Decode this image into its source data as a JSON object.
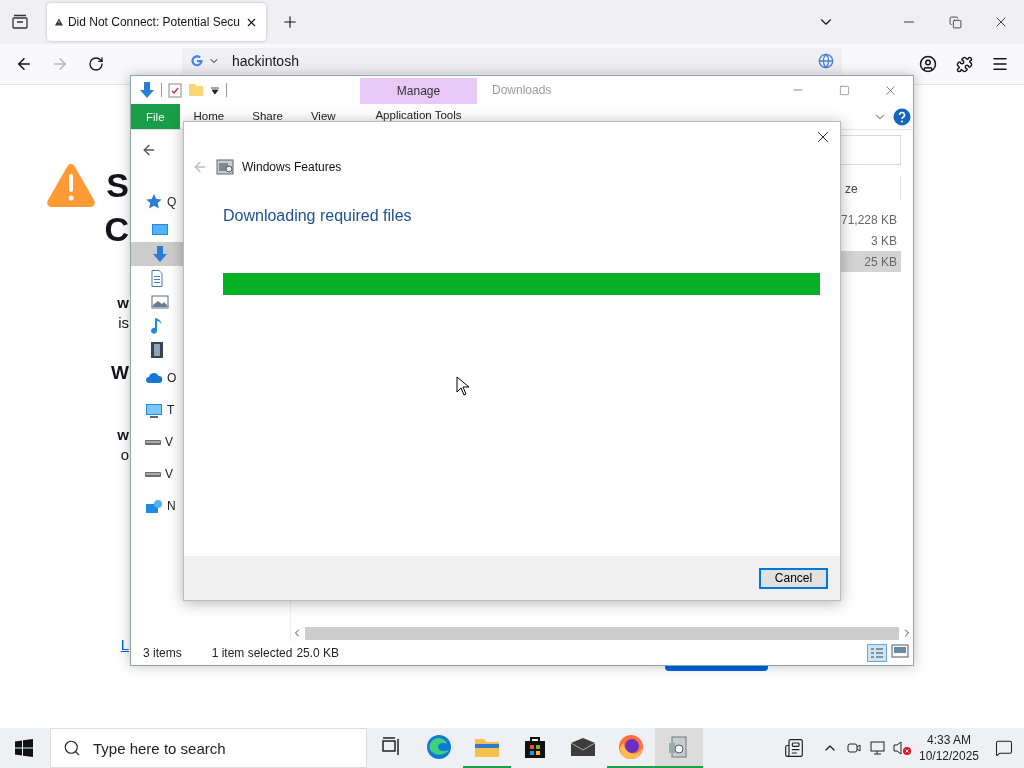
{
  "browser": {
    "tab": {
      "title": "Did Not Connect: Potential Secu",
      "selected": true
    },
    "address": {
      "value": "hackintosh"
    },
    "page": {
      "blocks": [
        {
          "kind": "heading",
          "lines": [
            "S",
            "C"
          ]
        },
        {
          "kind": "paragraph",
          "lines": [
            "w",
            "is"
          ]
        },
        {
          "kind": "subheading",
          "lines": [
            "W"
          ]
        },
        {
          "kind": "paragraph",
          "lines": [
            "w",
            "o"
          ]
        },
        {
          "kind": "link",
          "lines": [
            "L"
          ]
        }
      ]
    }
  },
  "explorer": {
    "title": "Downloads",
    "ribbon_tabs": [
      {
        "label": "File",
        "kind": "file"
      },
      {
        "label": "Home",
        "kind": "tab"
      },
      {
        "label": "Share",
        "kind": "tab"
      },
      {
        "label": "View",
        "kind": "tab"
      }
    ],
    "context_tab": {
      "group": "Manage",
      "label": "Application Tools"
    },
    "nav_items": [
      {
        "label": "Q",
        "kind": "star",
        "selected": false,
        "children": [
          {
            "kind": "desktop",
            "selected": false
          },
          {
            "kind": "download",
            "selected": true
          },
          {
            "kind": "document",
            "selected": false
          },
          {
            "kind": "picture",
            "selected": false
          },
          {
            "kind": "music",
            "selected": false
          },
          {
            "kind": "video",
            "selected": false
          }
        ]
      },
      {
        "label": "O",
        "kind": "cloud",
        "selected": false
      },
      {
        "label": "T",
        "kind": "pc",
        "selected": false
      },
      {
        "label": "V",
        "kind": "drive",
        "selected": false
      },
      {
        "label": "V",
        "kind": "drive",
        "selected": false
      },
      {
        "label": "N",
        "kind": "network",
        "selected": false
      }
    ],
    "column_header": "ze",
    "rows": [
      {
        "size": "71,228 KB",
        "selected": false
      },
      {
        "size": "3 KB",
        "selected": false
      },
      {
        "size": "25 KB",
        "selected": true
      }
    ],
    "status": {
      "count": "3 items",
      "selection": "1 item selected",
      "size": "25.0 KB"
    }
  },
  "dialog": {
    "app_title": "Windows Features",
    "heading": "Downloading required files",
    "progress": {
      "level": 1
    },
    "buttons": [
      "Cancel"
    ]
  },
  "taskbar": {
    "search_placeholder": "Type here to search",
    "apps": [
      {
        "kind": "taskview",
        "running": false,
        "selected": false
      },
      {
        "kind": "edge",
        "running": false,
        "selected": false
      },
      {
        "kind": "explorer",
        "running": true,
        "selected": false
      },
      {
        "kind": "store",
        "running": false,
        "selected": false
      },
      {
        "kind": "mail",
        "running": false,
        "selected": false
      },
      {
        "kind": "firefox",
        "running": true,
        "selected": false
      },
      {
        "kind": "features",
        "running": true,
        "selected": true
      }
    ],
    "time": "4:33 AM",
    "date": "10/12/2025"
  }
}
